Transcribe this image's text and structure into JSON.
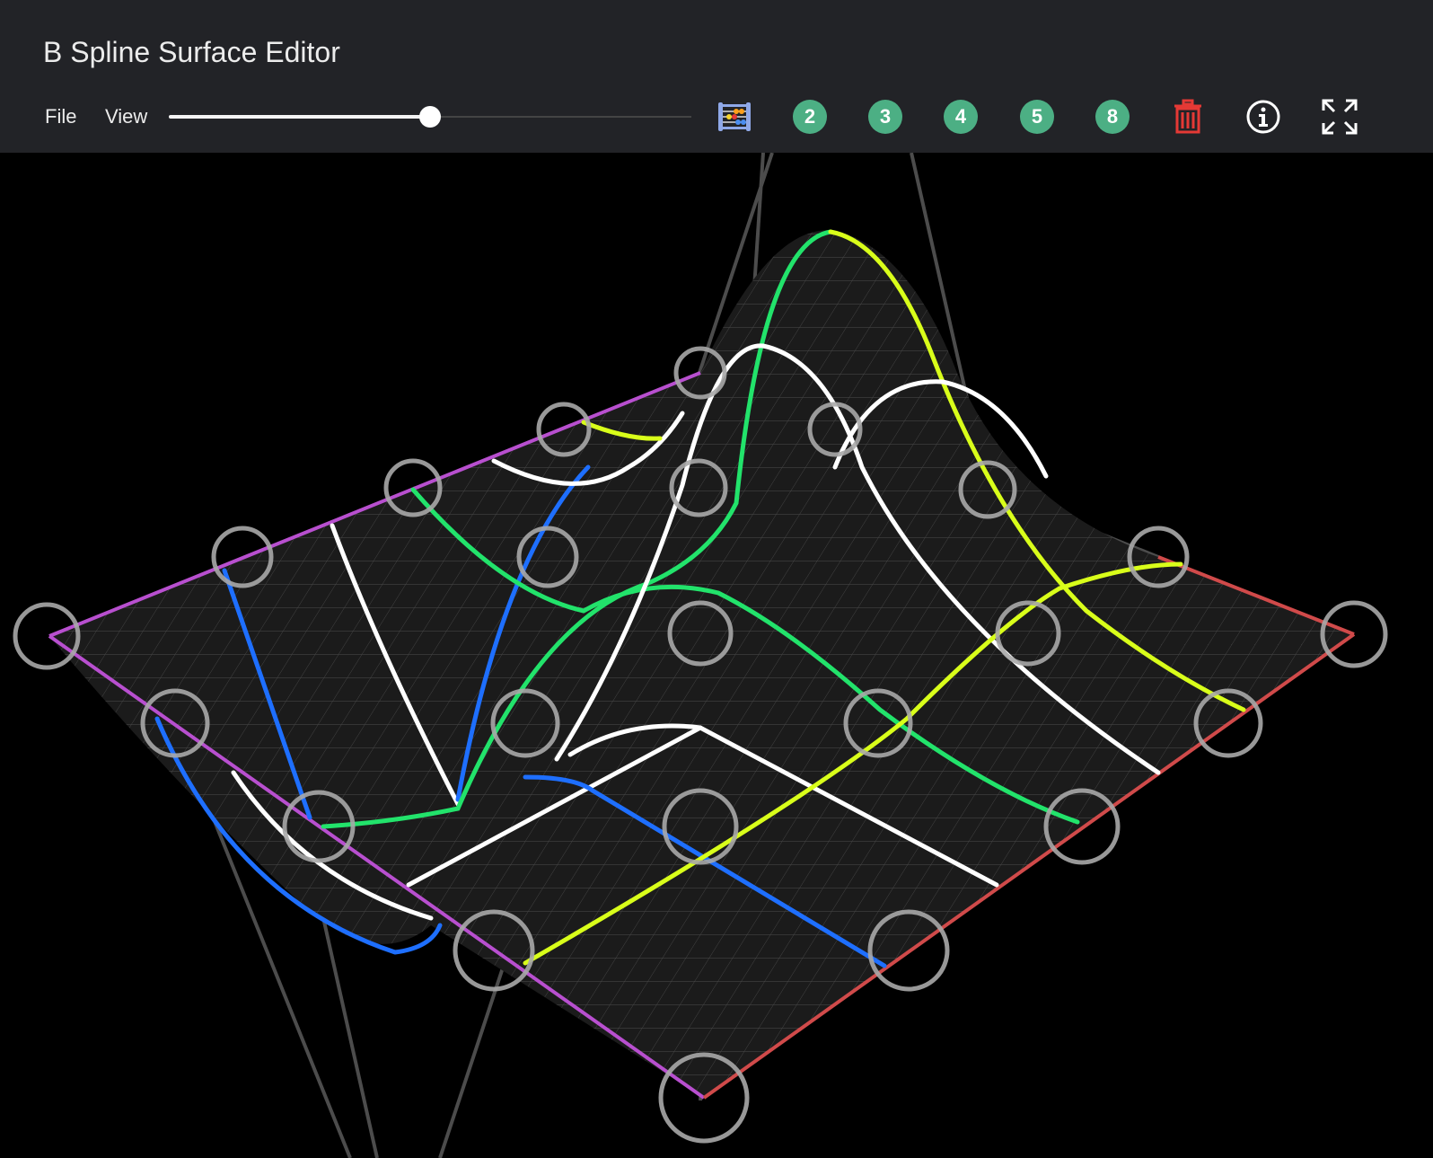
{
  "app": {
    "title": "B Spline Surface Editor"
  },
  "menu": {
    "file": "File",
    "view": "View"
  },
  "slider": {
    "value_fraction": 0.5
  },
  "toolbar": {
    "knots_icon": "abacus-icon",
    "degree_buttons": [
      "2",
      "3",
      "4",
      "5",
      "8"
    ],
    "delete_icon": "trash-icon",
    "info_icon": "info-icon",
    "fullscreen_icon": "fullscreen-icon"
  },
  "colors": {
    "header_bg": "#222327",
    "accent_degree": "#4caf84",
    "delete": "#e53935",
    "edge_u": "#b84fcf",
    "edge_v": "#d04a4a",
    "isoline_blue": "#1e6fff",
    "isoline_green": "#22e36b",
    "isoline_yellow": "#d9ff1a",
    "isoline_white": "#ffffff"
  }
}
